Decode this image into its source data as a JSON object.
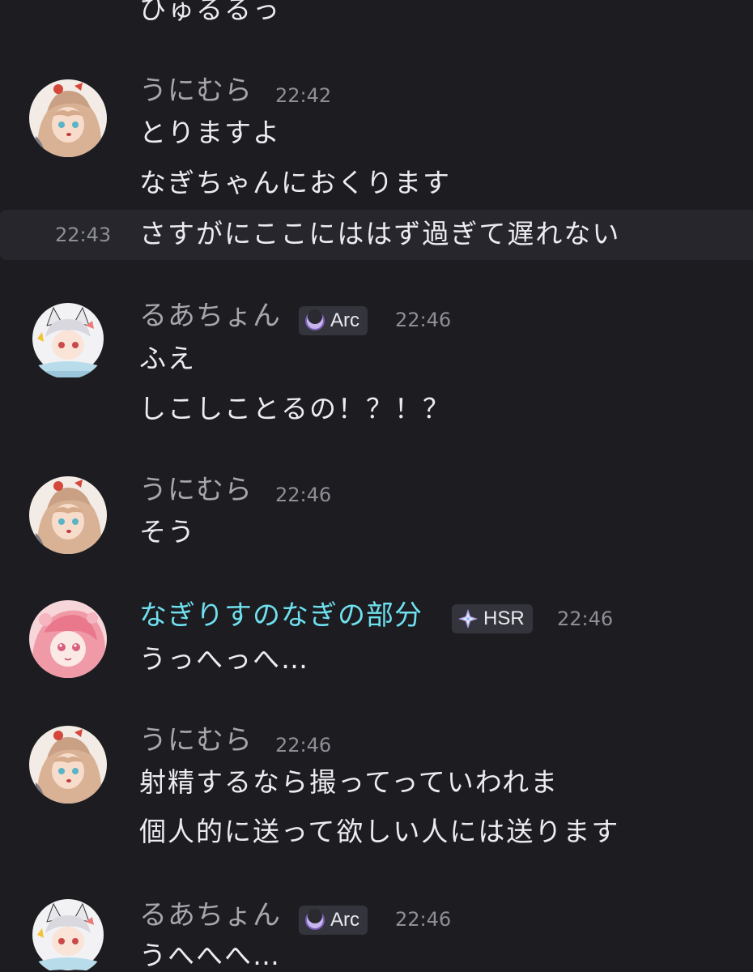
{
  "theme": {
    "background": "#1c1c21",
    "hover_row": "#26262c",
    "username_default": "#a6a7ad",
    "username_role": "#6fe0ee",
    "badge_bg": "#34353c"
  },
  "top_fragment": "ひゅるるっ",
  "messages": [
    {
      "author": "うにむら",
      "time": "22:42",
      "avatar_icon": "user-avatar-unimura",
      "lines": [
        "とりますよ",
        "なぎちゃんにおくります"
      ],
      "followup": {
        "time": "22:43",
        "text": "さすがにここにははず過ぎて遅れない"
      }
    },
    {
      "author": "るあちょん",
      "badge": {
        "label": "Arc",
        "icon": "crescent-moon-icon"
      },
      "time": "22:46",
      "avatar_icon": "user-avatar-ruachon",
      "lines": [
        "ふえ",
        "しこしことるの！？！？"
      ]
    },
    {
      "author": "うにむら",
      "time": "22:46",
      "avatar_icon": "user-avatar-unimura",
      "lines": [
        "そう"
      ]
    },
    {
      "author": "なぎりすのなぎの部分",
      "badge": {
        "label": "HSR",
        "icon": "star-sparkle-icon"
      },
      "time": "22:46",
      "avatar_icon": "user-avatar-nagirisu",
      "lines": [
        "うっへっへ…"
      ]
    },
    {
      "author": "うにむら",
      "time": "22:46",
      "avatar_icon": "user-avatar-unimura",
      "lines": [
        "射精するなら撮ってっていわれま",
        "個人的に送って欲しい人には送ります"
      ]
    },
    {
      "author": "るあちょん",
      "badge": {
        "label": "Arc",
        "icon": "crescent-moon-icon"
      },
      "time": "22:46",
      "avatar_icon": "user-avatar-ruachon",
      "lines": [
        "うへへへ…"
      ]
    }
  ]
}
